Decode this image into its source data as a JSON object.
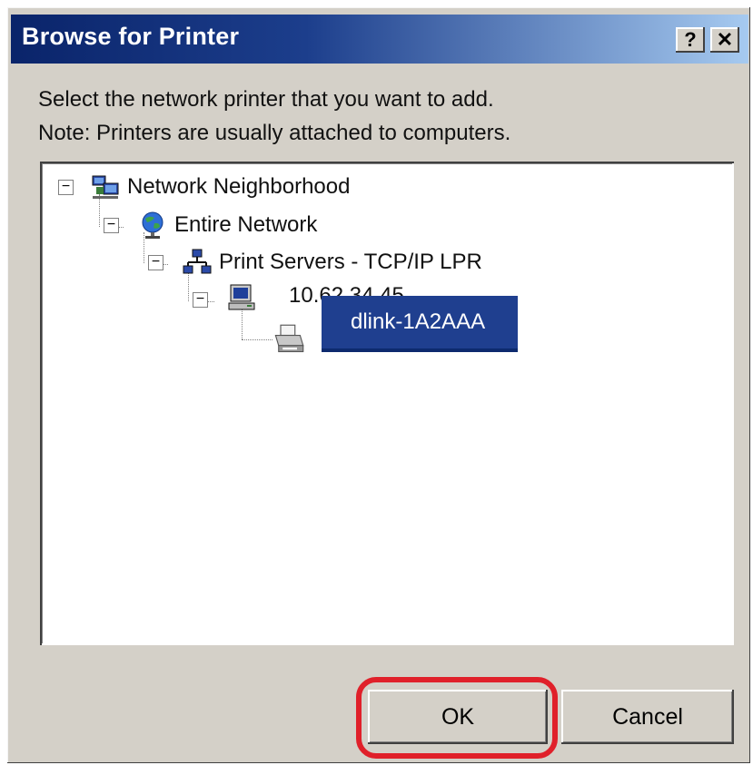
{
  "window": {
    "title": "Browse for Printer",
    "help_label": "?",
    "close_label": "✕"
  },
  "instructions": {
    "line1": "Select the network printer that you want to add.",
    "line2": "Note: Printers are usually attached to computers."
  },
  "tree": {
    "nodes": [
      {
        "label": "Network Neighborhood",
        "icon": "network-neighborhood-icon",
        "expanded": true
      },
      {
        "label": "Entire Network",
        "icon": "globe-icon",
        "expanded": true
      },
      {
        "label": "Print Servers - TCP/IP LPR",
        "icon": "print-servers-icon",
        "expanded": true
      },
      {
        "label": "10.62.34.45",
        "icon": "computer-icon",
        "expanded": true
      },
      {
        "label": "dlink-1A2AAA",
        "icon": "printer-icon",
        "selected": true
      }
    ],
    "toggle_symbol": "−"
  },
  "buttons": {
    "ok": "OK",
    "cancel": "Cancel"
  },
  "colors": {
    "titlebar_start": "#0a246a",
    "titlebar_end": "#a6caf0",
    "selection": "#1f3f8f",
    "highlight_ring": "#e0202a",
    "face": "#d4d0c8"
  }
}
